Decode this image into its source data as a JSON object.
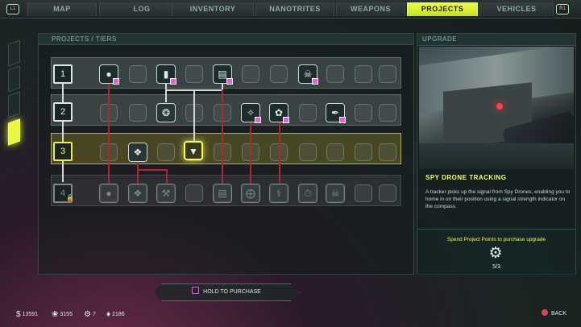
{
  "tabs": [
    {
      "label": "MAP"
    },
    {
      "label": "LOG"
    },
    {
      "label": "INVENTORY"
    },
    {
      "label": "NANOTRITES"
    },
    {
      "label": "WEAPONS"
    },
    {
      "label": "PROJECTS",
      "active": true
    },
    {
      "label": "VEHICLES"
    }
  ],
  "shoulders": {
    "left": "L1",
    "right": "R1"
  },
  "projects_panel": {
    "title": "PROJECTS / TIERS"
  },
  "tiers": [
    {
      "label": "1",
      "state": "unlocked"
    },
    {
      "label": "2",
      "state": "unlocked"
    },
    {
      "label": "3",
      "state": "active"
    },
    {
      "label": "4",
      "state": "locked"
    }
  ],
  "upgrade_panel": {
    "header": "UPGRADE",
    "title": "SPY DRONE TRACKING",
    "description": "A tracker picks up the signal from Spy Drones, enabling you to home in on their position using a signal strength indicator on the compass.",
    "spend_text": "Spend Project Points to purchase upgrade",
    "cost": "5/3"
  },
  "hold_button": {
    "label": "HOLD TO PURCHASE"
  },
  "resources": [
    {
      "icon": "dollar-icon",
      "glyph": "$",
      "value": "13591"
    },
    {
      "icon": "feltrite-icon",
      "glyph": "❀",
      "value": "3155"
    },
    {
      "icon": "project-points-icon",
      "glyph": "⚙",
      "value": "7"
    },
    {
      "icon": "ark-icon",
      "glyph": "♦",
      "value": "2186"
    }
  ],
  "back": {
    "label": "BACK"
  },
  "colors": {
    "accent": "#f0ff50",
    "owned_marker": "#e060e0",
    "link_line": "#c02828"
  }
}
